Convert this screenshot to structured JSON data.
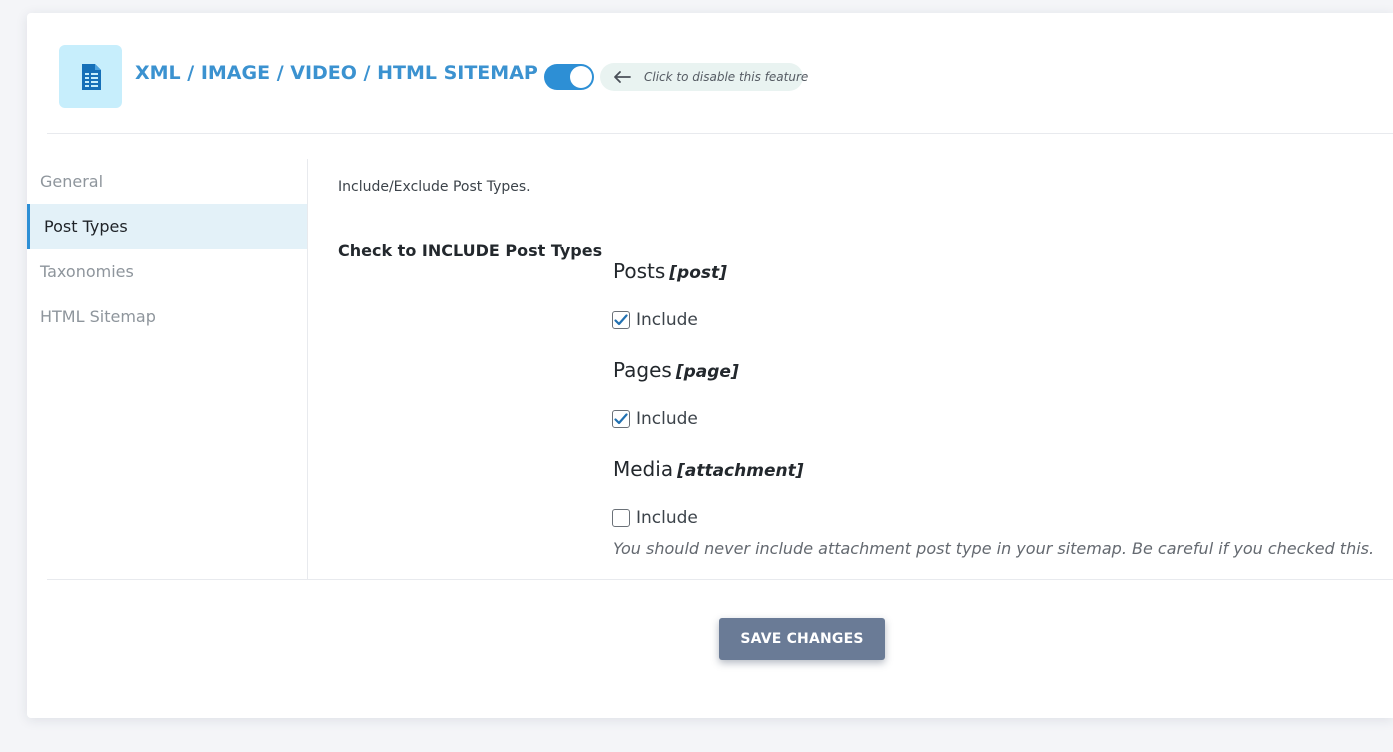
{
  "header": {
    "title": "XML / IMAGE / VIDEO / HTML SITEMAP",
    "logo_icon": "sitemap-document-icon",
    "toggle_state": "on",
    "toggle_hint": "Click to disable this feature",
    "accent_color": "#2d8fd5"
  },
  "sidebar": {
    "items": [
      {
        "label": "General",
        "active": false
      },
      {
        "label": "Post Types",
        "active": true
      },
      {
        "label": "Taxonomies",
        "active": false
      },
      {
        "label": "HTML Sitemap",
        "active": false
      }
    ]
  },
  "main": {
    "description": "Include/Exclude Post Types.",
    "field_label": "Check to INCLUDE Post Types",
    "post_types": [
      {
        "name": "Posts",
        "slug": "[post]",
        "check_label": "Include",
        "checked": true
      },
      {
        "name": "Pages",
        "slug": "[page]",
        "check_label": "Include",
        "checked": true
      },
      {
        "name": "Media",
        "slug": "[attachment]",
        "check_label": "Include",
        "checked": false
      }
    ],
    "attachment_note": "You should never include attachment post type in your sitemap. Be careful if you checked this."
  },
  "footer": {
    "save_label": "SAVE CHANGES"
  }
}
